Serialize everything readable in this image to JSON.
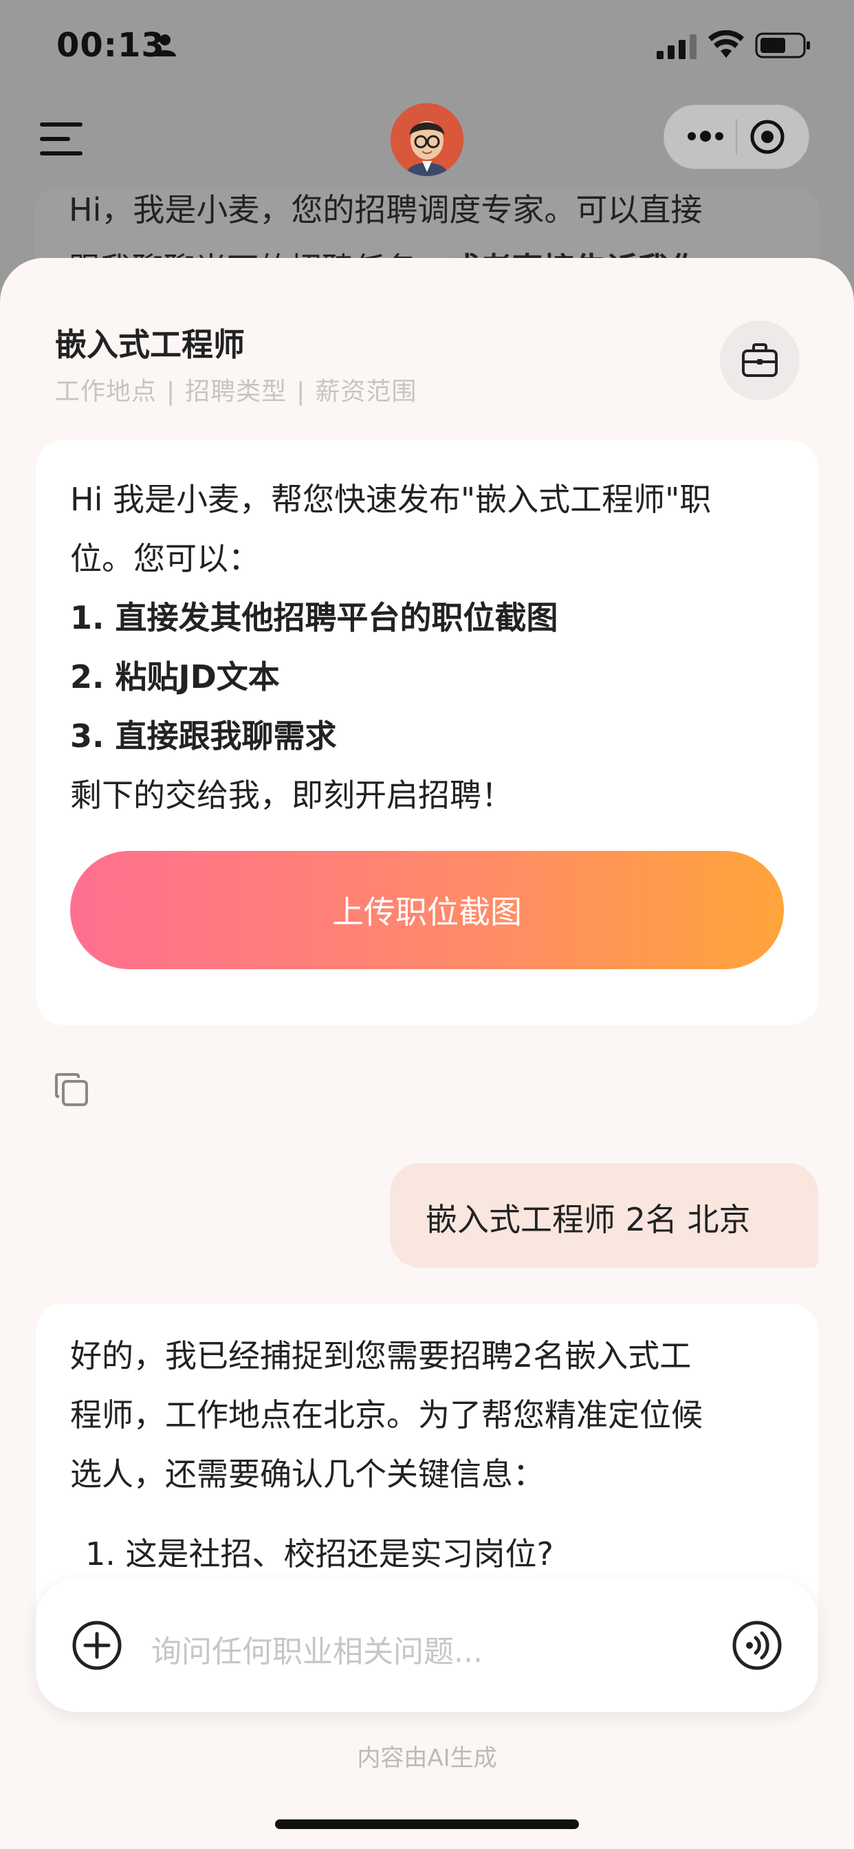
{
  "status_bar": {
    "time": "00:13"
  },
  "background": {
    "intro_line1": "Hi，我是小麦，您的招聘调度专家。可以直接",
    "intro_line2_normal": "跟我聊聊当下的招聘任务，",
    "intro_line2_bold": "或者直接告诉我你"
  },
  "sheet": {
    "job_title": "嵌入式工程师",
    "job_meta": [
      "工作地点",
      "招聘类型",
      "薪资范围"
    ],
    "meta_separator": "|",
    "bot_message": {
      "line1": "Hi 我是小麦，帮您快速发布\"嵌入式工程师\"职",
      "line2": "位。您可以：",
      "option1": "1. 直接发其他招聘平台的职位截图",
      "option2": "2. 粘贴JD文本",
      "option3": "3. 直接跟我聊需求",
      "line_end": "剩下的交给我，即刻开启招聘！",
      "upload_button": "上传职位截图"
    },
    "user_message": "嵌入式工程师 2名 北京",
    "bot_reply": {
      "line1": "好的，我已经捕捉到您需要招聘2名嵌入式工",
      "line2": "程师，工作地点在北京。为了帮您精准定位候",
      "line3": "选人，还需要确认几个关键信息：",
      "list_item1": "1.   这是社招、校招还是实习岗位?"
    },
    "input_placeholder": "询问任何职业相关问题...",
    "ai_note": "内容由AI生成"
  },
  "colors": {
    "upload_gradient_start": "#ff6f8f",
    "upload_gradient_end": "#ffa43a",
    "user_bubble": "#f8e6df",
    "sheet_bg": "#fcf6f5"
  }
}
